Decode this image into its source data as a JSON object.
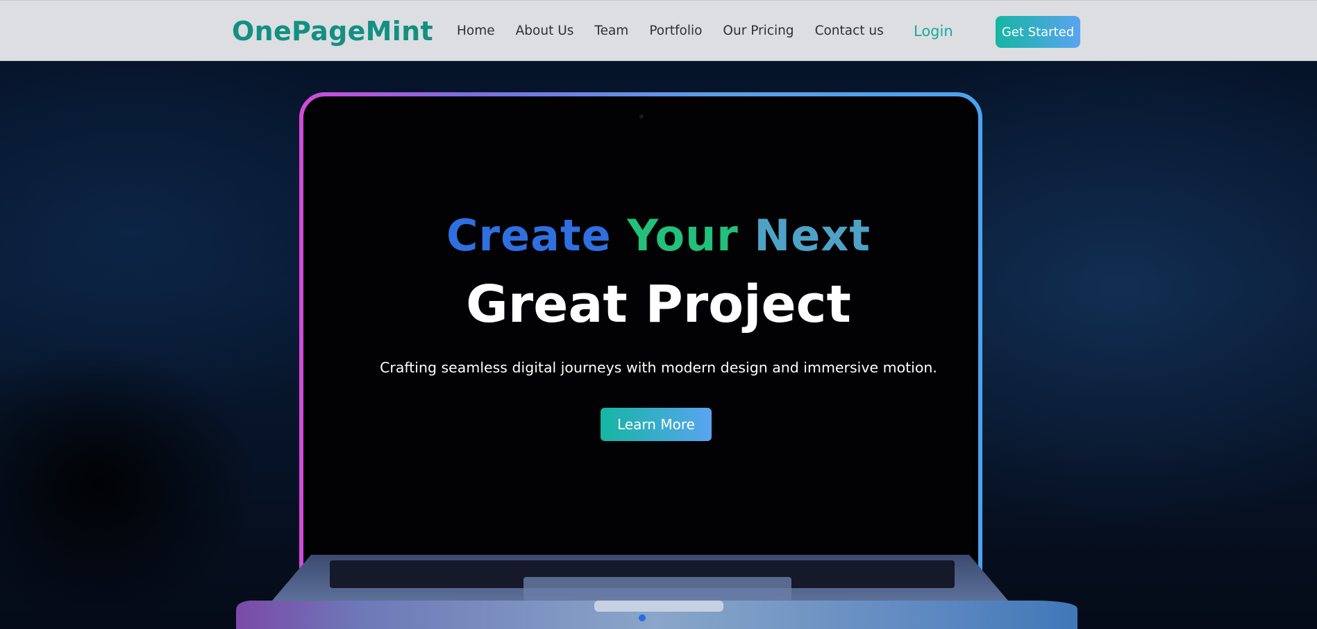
{
  "nav": {
    "brand": "OnePageMint",
    "items": [
      {
        "label": "Home"
      },
      {
        "label": "About Us"
      },
      {
        "label": "Team"
      },
      {
        "label": "Portfolio"
      },
      {
        "label": "Our Pricing"
      },
      {
        "label": "Contact us"
      }
    ],
    "login_label": "Login",
    "cta_label": "Get Started"
  },
  "hero": {
    "headline_words": [
      "Create",
      "Your",
      "Next"
    ],
    "headline_line2": "Great Project",
    "subtitle": "Crafting seamless digital journeys with modern design and immersive motion.",
    "button_label": "Learn More",
    "background_image": "laptop-illustration"
  },
  "colors": {
    "brand": "#138f83",
    "login": "#19a89b",
    "gradient_start": "#16b5a3",
    "gradient_end": "#5aa4f0",
    "headline_create": "#2f6fe0",
    "headline_your": "#22c07a",
    "headline_next": "#4ea2c6"
  }
}
